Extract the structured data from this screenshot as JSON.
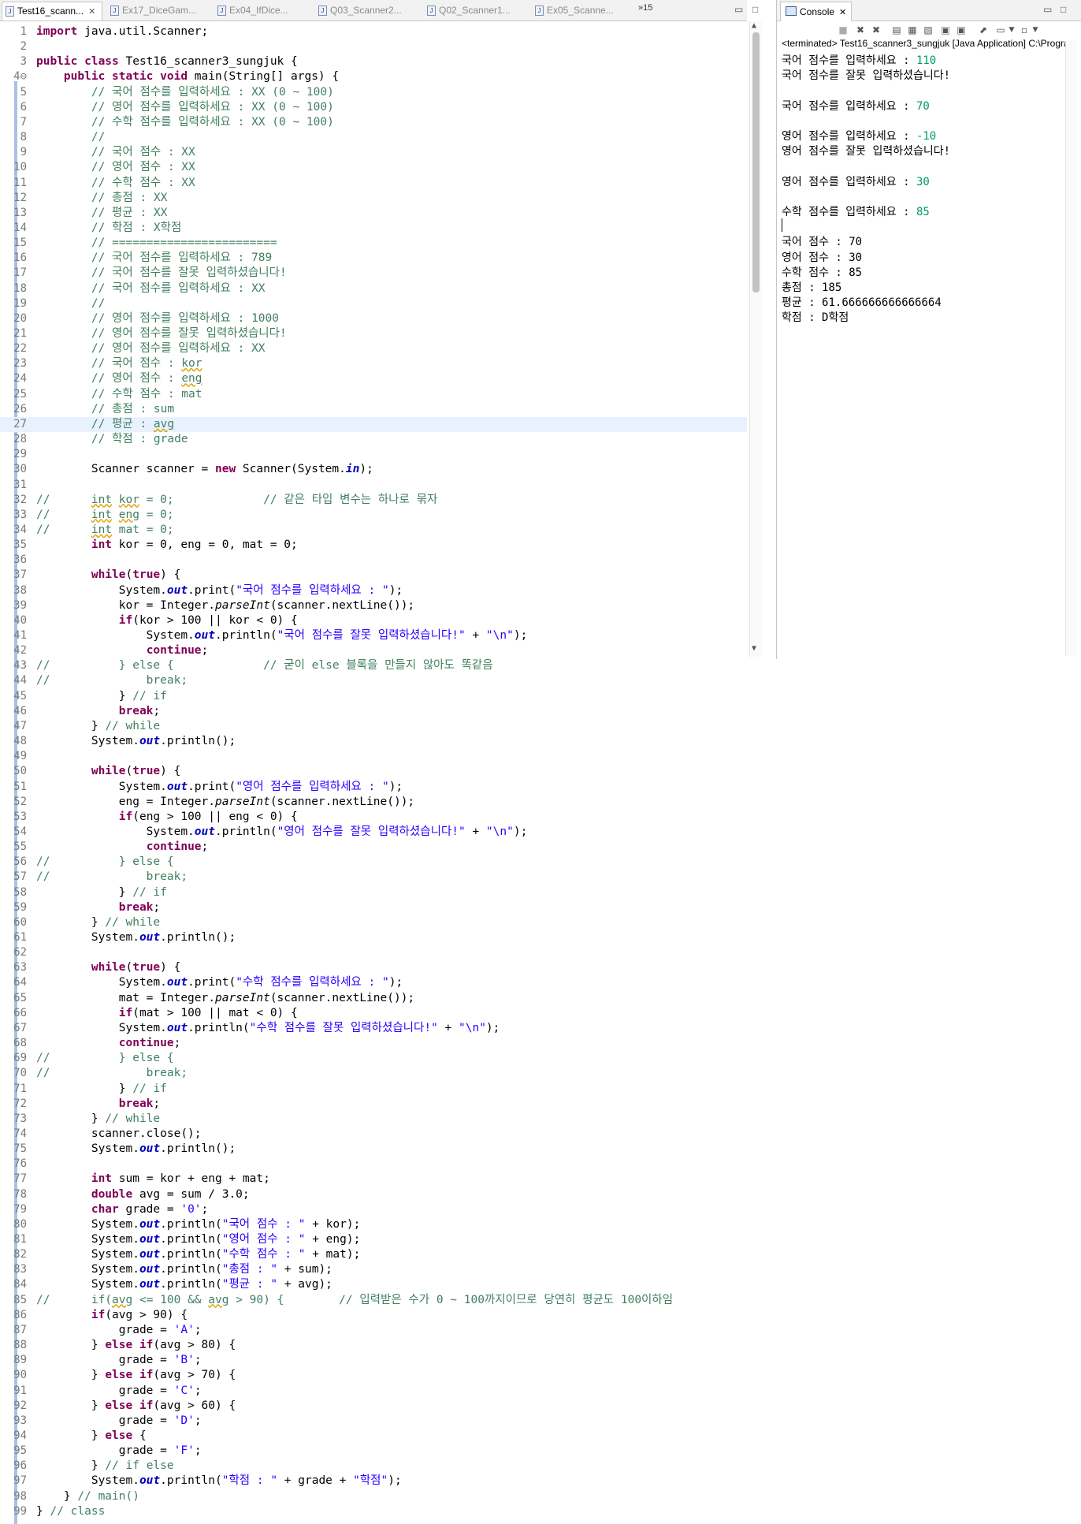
{
  "editor": {
    "tabs": [
      {
        "label": "Test16_scann...",
        "active": true
      },
      {
        "label": "Ex17_DiceGam...",
        "active": false
      },
      {
        "label": "Ex04_IfDice...",
        "active": false
      },
      {
        "label": "Q03_Scanner2...",
        "active": false
      },
      {
        "label": "Q02_Scanner1...",
        "active": false
      },
      {
        "label": "Ex05_Scanne...",
        "active": false
      }
    ],
    "overflow_label": "»15",
    "lines": [
      {
        "n": "1",
        "h": "<span class=\"kw\">import</span> java.util.Scanner;"
      },
      {
        "n": "2",
        "h": ""
      },
      {
        "n": "3",
        "h": "<span class=\"kw\">public class</span> Test16_scanner3_sungjuk {"
      },
      {
        "n": "4⊖",
        "h": "    <span class=\"kw\">public static void</span> main(String[] args) {"
      },
      {
        "n": "5",
        "h": "        <span class=\"cm\">// 국어 점수를 입력하세요 : XX (0 ~ 100)</span>"
      },
      {
        "n": "6",
        "h": "        <span class=\"cm\">// 영어 점수를 입력하세요 : XX (0 ~ 100)</span>"
      },
      {
        "n": "7",
        "h": "        <span class=\"cm\">// 수학 점수를 입력하세요 : XX (0 ~ 100)</span>"
      },
      {
        "n": "8",
        "h": "        <span class=\"cm\">//</span>"
      },
      {
        "n": "9",
        "h": "        <span class=\"cm\">// 국어 점수 : XX</span>"
      },
      {
        "n": "10",
        "h": "        <span class=\"cm\">// 영어 점수 : XX</span>"
      },
      {
        "n": "11",
        "h": "        <span class=\"cm\">// 수학 점수 : XX</span>"
      },
      {
        "n": "12",
        "h": "        <span class=\"cm\">// 총점 : XX</span>"
      },
      {
        "n": "13",
        "h": "        <span class=\"cm\">// 평균 : XX</span>"
      },
      {
        "n": "14",
        "h": "        <span class=\"cm\">// 학점 : X학점</span>"
      },
      {
        "n": "15",
        "h": "        <span class=\"cm\">// ========================</span>"
      },
      {
        "n": "16",
        "h": "        <span class=\"cm\">// 국어 점수를 입력하세요 : 789</span>"
      },
      {
        "n": "17",
        "h": "        <span class=\"cm\">// 국어 점수를 잘못 입력하셨습니다!</span>"
      },
      {
        "n": "18",
        "h": "        <span class=\"cm\">// 국어 점수를 입력하세요 : XX</span>"
      },
      {
        "n": "19",
        "h": "        <span class=\"cm\">//</span>"
      },
      {
        "n": "20",
        "h": "        <span class=\"cm\">// 영어 점수를 입력하세요 : 1000</span>"
      },
      {
        "n": "21",
        "h": "        <span class=\"cm\">// 영어 점수를 잘못 입력하셨습니다!</span>"
      },
      {
        "n": "22",
        "h": "        <span class=\"cm\">// 영어 점수를 입력하세요 : XX</span>"
      },
      {
        "n": "23",
        "h": "        <span class=\"cm\">// 국어 점수 : <span class=\"sq\">kor</span></span>"
      },
      {
        "n": "24",
        "h": "        <span class=\"cm\">// 영어 점수 : <span class=\"sq\">eng</span></span>"
      },
      {
        "n": "25",
        "h": "        <span class=\"cm\">// 수학 점수 : mat</span>"
      },
      {
        "n": "26",
        "h": "        <span class=\"cm\">// 총점 : sum</span>"
      },
      {
        "n": "27",
        "h": "        <span class=\"cm\">// 평균 : <span class=\"sq\">avg</span></span>",
        "hl": true
      },
      {
        "n": "28",
        "h": "        <span class=\"cm\">// 학점 : grade</span>"
      },
      {
        "n": "29",
        "h": ""
      },
      {
        "n": "30",
        "h": "        Scanner scanner = <span class=\"kw\">new</span> Scanner(System.<span class=\"fld\">in</span>);"
      },
      {
        "n": "31",
        "h": ""
      },
      {
        "n": "32",
        "h": "<span class=\"cm\">//      <span class=\"sq\">int</span> <span class=\"sq\">kor</span> = 0;             // 같은 타입 변수는 하나로 묶자</span>"
      },
      {
        "n": "33",
        "h": "<span class=\"cm\">//      <span class=\"sq\">int</span> <span class=\"sq\">eng</span> = 0;</span>"
      },
      {
        "n": "34",
        "h": "<span class=\"cm\">//      <span class=\"sq\">int</span> mat = 0;</span>"
      },
      {
        "n": "35",
        "h": "        <span class=\"kw\">int</span> kor = 0, eng = 0, mat = 0;"
      },
      {
        "n": "36",
        "h": ""
      },
      {
        "n": "37",
        "h": "        <span class=\"kw\">while</span>(<span class=\"kw\">true</span>) {"
      },
      {
        "n": "38",
        "h": "            System.<span class=\"fld\">out</span>.print(<span class=\"st\">\"국어 점수를 입력하세요 : \"</span>);"
      },
      {
        "n": "39",
        "h": "            kor = Integer.<span class=\"it\">parseInt</span>(scanner.nextLine());"
      },
      {
        "n": "40",
        "h": "            <span class=\"kw\">if</span>(kor > 100 || kor < 0) {"
      },
      {
        "n": "41",
        "h": "                System.<span class=\"fld\">out</span>.println(<span class=\"st\">\"국어 점수를 잘못 입력하셨습니다!\"</span> + <span class=\"st\">\"\\n\"</span>);"
      },
      {
        "n": "42",
        "h": "                <span class=\"kw\">continue</span>;"
      },
      {
        "n": "43",
        "h": "<span class=\"cm\">//          } else {             // 굳이 else 블록을 만들지 않아도 똑같음</span>"
      },
      {
        "n": "44",
        "h": "<span class=\"cm\">//              break;</span>"
      },
      {
        "n": "45",
        "h": "            } <span class=\"cm\">// if</span>"
      },
      {
        "n": "46",
        "h": "            <span class=\"kw\">break</span>;"
      },
      {
        "n": "47",
        "h": "        } <span class=\"cm\">// while</span>"
      },
      {
        "n": "48",
        "h": "        System.<span class=\"fld\">out</span>.println();"
      },
      {
        "n": "49",
        "h": ""
      },
      {
        "n": "50",
        "h": "        <span class=\"kw\">while</span>(<span class=\"kw\">true</span>) {"
      },
      {
        "n": "51",
        "h": "            System.<span class=\"fld\">out</span>.print(<span class=\"st\">\"영어 점수를 입력하세요 : \"</span>);"
      },
      {
        "n": "52",
        "h": "            eng = Integer.<span class=\"it\">parseInt</span>(scanner.nextLine());"
      },
      {
        "n": "53",
        "h": "            <span class=\"kw\">if</span>(eng > 100 || eng < 0) {"
      },
      {
        "n": "54",
        "h": "                System.<span class=\"fld\">out</span>.println(<span class=\"st\">\"영어 점수를 잘못 입력하셨습니다!\"</span> + <span class=\"st\">\"\\n\"</span>);"
      },
      {
        "n": "55",
        "h": "                <span class=\"kw\">continue</span>;"
      },
      {
        "n": "56",
        "h": "<span class=\"cm\">//          } else {</span>"
      },
      {
        "n": "57",
        "h": "<span class=\"cm\">//              break;</span>"
      },
      {
        "n": "58",
        "h": "            } <span class=\"cm\">// if</span>"
      },
      {
        "n": "59",
        "h": "            <span class=\"kw\">break</span>;"
      },
      {
        "n": "60",
        "h": "        } <span class=\"cm\">// while</span>"
      },
      {
        "n": "61",
        "h": "        System.<span class=\"fld\">out</span>.println();"
      },
      {
        "n": "62",
        "h": ""
      },
      {
        "n": "63",
        "h": "        <span class=\"kw\">while</span>(<span class=\"kw\">true</span>) {"
      },
      {
        "n": "64",
        "h": "            System.<span class=\"fld\">out</span>.print(<span class=\"st\">\"수학 점수를 입력하세요 : \"</span>);"
      },
      {
        "n": "65",
        "h": "            mat = Integer.<span class=\"it\">parseInt</span>(scanner.nextLine());"
      },
      {
        "n": "66",
        "h": "            <span class=\"kw\">if</span>(mat > 100 || mat < 0) {"
      },
      {
        "n": "67",
        "h": "            System.<span class=\"fld\">out</span>.println(<span class=\"st\">\"수학 점수를 잘못 입력하셨습니다!\"</span> + <span class=\"st\">\"\\n\"</span>);"
      },
      {
        "n": "68",
        "h": "            <span class=\"kw\">continue</span>;"
      },
      {
        "n": "69",
        "h": "<span class=\"cm\">//          } else {</span>"
      },
      {
        "n": "70",
        "h": "<span class=\"cm\">//              break;</span>"
      },
      {
        "n": "71",
        "h": "            } <span class=\"cm\">// if</span>"
      },
      {
        "n": "72",
        "h": "            <span class=\"kw\">break</span>;"
      },
      {
        "n": "73",
        "h": "        } <span class=\"cm\">// while</span>"
      },
      {
        "n": "74",
        "h": "        scanner.close();"
      },
      {
        "n": "75",
        "h": "        System.<span class=\"fld\">out</span>.println();"
      },
      {
        "n": "76",
        "h": ""
      },
      {
        "n": "77",
        "h": "        <span class=\"kw\">int</span> sum = kor + eng + mat;"
      },
      {
        "n": "78",
        "h": "        <span class=\"kw\">double</span> avg = sum / 3.0;"
      },
      {
        "n": "79",
        "h": "        <span class=\"kw\">char</span> grade = <span class=\"st\">'0'</span>;"
      },
      {
        "n": "80",
        "h": "        System.<span class=\"fld\">out</span>.println(<span class=\"st\">\"국어 점수 : \"</span> + kor);"
      },
      {
        "n": "81",
        "h": "        System.<span class=\"fld\">out</span>.println(<span class=\"st\">\"영어 점수 : \"</span> + eng);"
      },
      {
        "n": "82",
        "h": "        System.<span class=\"fld\">out</span>.println(<span class=\"st\">\"수학 점수 : \"</span> + mat);"
      },
      {
        "n": "83",
        "h": "        System.<span class=\"fld\">out</span>.println(<span class=\"st\">\"총점 : \"</span> + sum);"
      },
      {
        "n": "84",
        "h": "        System.<span class=\"fld\">out</span>.println(<span class=\"st\">\"평균 : \"</span> + avg);"
      },
      {
        "n": "85",
        "h": "<span class=\"cm\">//      if(<span class=\"sq\">avg</span> <= 100 && <span class=\"sq\">avg</span> > 90) {        // 입력받은 수가 0 ~ 100까지이므로 당연히 평균도 100이하임</span>"
      },
      {
        "n": "86",
        "h": "        <span class=\"kw\">if</span>(avg > 90) {"
      },
      {
        "n": "87",
        "h": "            grade = <span class=\"st\">'A'</span>;"
      },
      {
        "n": "88",
        "h": "        } <span class=\"kw\">else if</span>(avg > 80) {"
      },
      {
        "n": "89",
        "h": "            grade = <span class=\"st\">'B'</span>;"
      },
      {
        "n": "90",
        "h": "        } <span class=\"kw\">else if</span>(avg > 70) {"
      },
      {
        "n": "91",
        "h": "            grade = <span class=\"st\">'C'</span>;"
      },
      {
        "n": "92",
        "h": "        } <span class=\"kw\">else if</span>(avg > 60) {"
      },
      {
        "n": "93",
        "h": "            grade = <span class=\"st\">'D'</span>;"
      },
      {
        "n": "94",
        "h": "        } <span class=\"kw\">else</span> {"
      },
      {
        "n": "95",
        "h": "            grade = <span class=\"st\">'F'</span>;"
      },
      {
        "n": "96",
        "h": "        } <span class=\"cm\">// if else</span>"
      },
      {
        "n": "97",
        "h": "        System.<span class=\"fld\">out</span>.println(<span class=\"st\">\"학점 : \"</span> + grade + <span class=\"st\">\"학점\"</span>);"
      },
      {
        "n": "98",
        "h": "    } <span class=\"cm\">// main()</span>"
      },
      {
        "n": "99",
        "h": "} <span class=\"cm\">// class</span>"
      }
    ]
  },
  "console": {
    "tab_label": "Console",
    "status": "<terminated> Test16_scanner3_sungjuk [Java Application] C:\\Progra",
    "lines": [
      {
        "text": "국어 점수를 입력하세요 : ",
        "input": "110"
      },
      {
        "text": "국어 점수를 잘못 입력하셨습니다!",
        "input": ""
      },
      {
        "text": "",
        "input": ""
      },
      {
        "text": "국어 점수를 입력하세요 : ",
        "input": "70"
      },
      {
        "text": "",
        "input": ""
      },
      {
        "text": "영어 점수를 입력하세요 : ",
        "input": "-10"
      },
      {
        "text": "영어 점수를 잘못 입력하셨습니다!",
        "input": ""
      },
      {
        "text": "",
        "input": ""
      },
      {
        "text": "영어 점수를 입력하세요 : ",
        "input": "30"
      },
      {
        "text": "",
        "input": ""
      },
      {
        "text": "수학 점수를 입력하세요 : ",
        "input": "85"
      },
      {
        "text": "",
        "input": ""
      },
      {
        "text": "국어 점수 : 70",
        "input": ""
      },
      {
        "text": "영어 점수 : 30",
        "input": ""
      },
      {
        "text": "수학 점수 : 85",
        "input": ""
      },
      {
        "text": "총점 : 185",
        "input": ""
      },
      {
        "text": "평균 : 61.666666666666664",
        "input": ""
      },
      {
        "text": "학점 : D학점",
        "input": ""
      }
    ]
  },
  "colors": {
    "keyword": "#7f0055",
    "comment": "#3f7f5f",
    "string": "#2a00ff",
    "field": "#0000c0",
    "console_input": "#009966",
    "current_line": "#e8f2fe"
  }
}
